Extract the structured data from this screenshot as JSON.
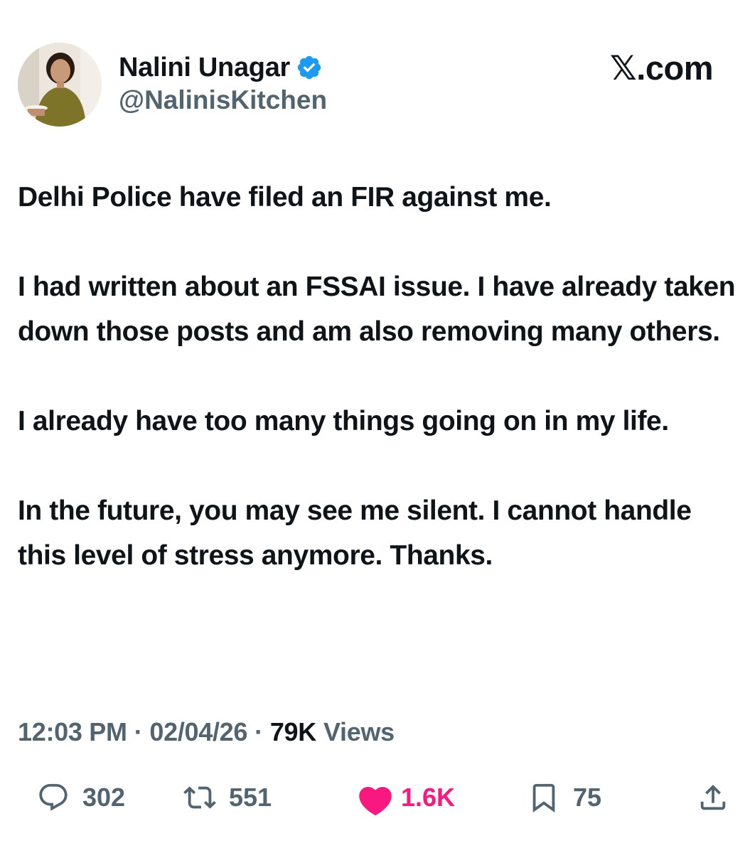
{
  "header": {
    "display_name": "Nalini Unagar",
    "handle": "@NalinisKitchen",
    "brand": "𝕏.com",
    "verified_color": "#1d9bf0"
  },
  "tweet": {
    "paragraphs": [
      "Delhi Police have filed an FIR against me.",
      "I had written about an FSSAI issue. I have already taken down those posts and am also removing many others.",
      "I already have too many things going on in my life.",
      "In the future, you may see me silent. I cannot handle this level of stress anymore. Thanks."
    ]
  },
  "meta": {
    "time": "12:03 PM",
    "separator": "·",
    "date": "02/04/26",
    "views_count": "79K",
    "views_label": "Views"
  },
  "actions": {
    "reply": {
      "icon": "reply-icon",
      "count": "302"
    },
    "repost": {
      "icon": "repost-icon",
      "count": "551"
    },
    "like": {
      "icon": "heart-icon",
      "count": "1.6K",
      "color": "#f91880",
      "liked": true
    },
    "bookmark": {
      "icon": "bookmark-icon",
      "count": "75"
    },
    "share": {
      "icon": "share-icon"
    }
  },
  "colors": {
    "text_primary": "#0f1419",
    "text_secondary": "#536471",
    "like": "#f91880",
    "verified": "#1d9bf0"
  }
}
